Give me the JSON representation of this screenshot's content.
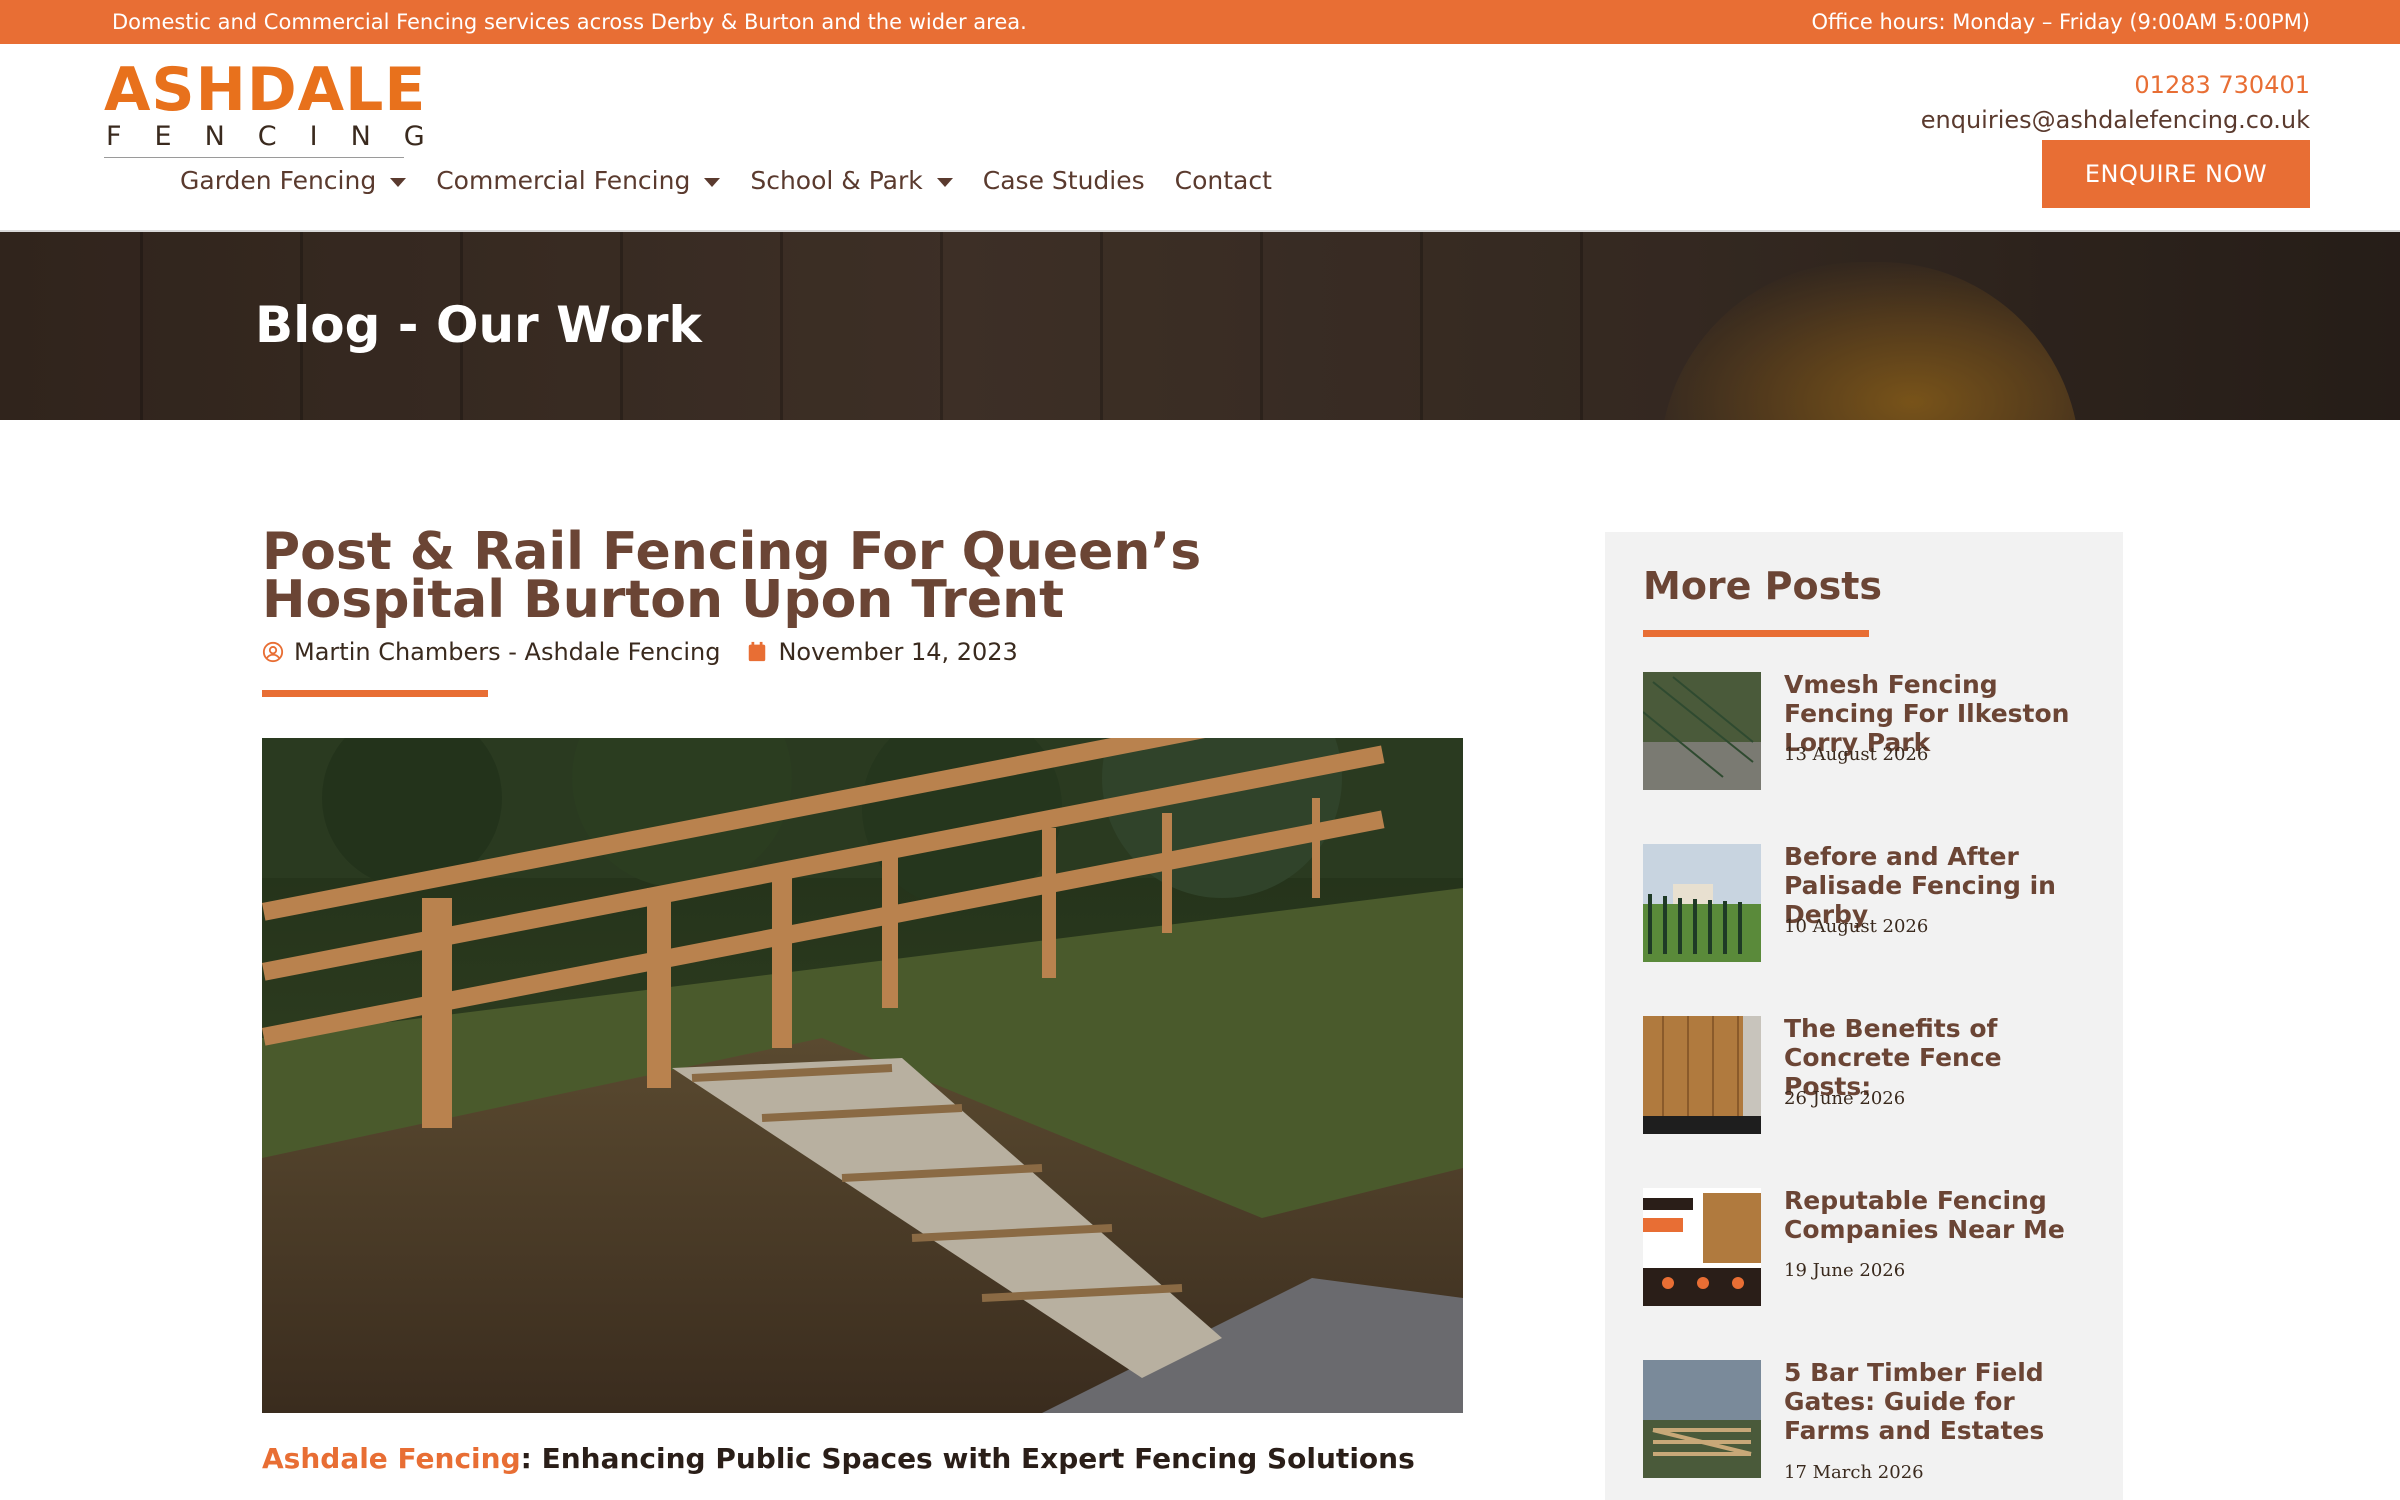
{
  "topbar": {
    "left_text": "Domestic and Commercial Fencing services across Derby & Burton and the wider area.",
    "right_text": "Office hours: Monday – Friday (9:00AM  5:00PM)"
  },
  "logo": {
    "brand": "ASHDALE",
    "sub": "FENCING"
  },
  "nav": {
    "items": [
      {
        "label": "Garden Fencing",
        "has_dropdown": true
      },
      {
        "label": "Commercial Fencing",
        "has_dropdown": true
      },
      {
        "label": "School & Park",
        "has_dropdown": true
      },
      {
        "label": "Case Studies",
        "has_dropdown": false
      },
      {
        "label": "Contact",
        "has_dropdown": false
      }
    ]
  },
  "contact": {
    "phone": "01283 730401",
    "email": "enquiries@ashdalefencing.co.uk",
    "cta": "ENQUIRE NOW"
  },
  "hero": {
    "title": "Blog - Our Work"
  },
  "article": {
    "title": "Post & Rail Fencing For Queen’s Hospital Burton Upon Trent",
    "author": "Martin Chambers - Ashdale Fencing",
    "date": "November 14, 2023",
    "lead_brand": "Ashdale Fencing",
    "lead_rest": ": Enhancing Public Spaces with Expert Fencing Solutions"
  },
  "sidebar": {
    "heading": "More Posts",
    "posts": [
      {
        "title": "Vmesh Fencing Fencing For Ilkeston Lorry Park",
        "date": "13 August 2026"
      },
      {
        "title": "Before and After Palisade Fencing in Derby",
        "date": "10 August 2026"
      },
      {
        "title": "The Benefits of Concrete Fence Posts:",
        "date": "26 June 2026"
      },
      {
        "title": "Reputable Fencing Companies Near Me",
        "date": "19 June 2026"
      },
      {
        "title": "5 Bar Timber Field Gates: Guide for Farms and Estates",
        "date": "17 March 2026"
      }
    ]
  },
  "colors": {
    "accent": "#e86e34",
    "heading": "#6b4535",
    "text": "#3a2a1e"
  }
}
